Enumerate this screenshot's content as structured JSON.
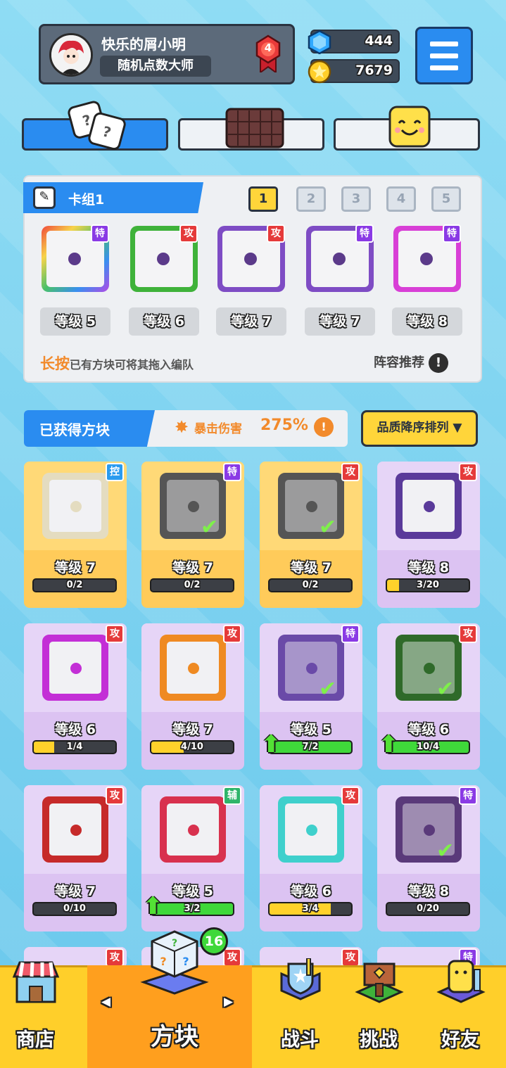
{
  "profile": {
    "name": "快乐的屑小明",
    "title": "随机点数大师",
    "rank": "4"
  },
  "currency": {
    "gems": "444",
    "coins": "7679"
  },
  "deck": {
    "title": "卡组1",
    "pages": [
      "1",
      "2",
      "3",
      "4",
      "5"
    ],
    "slots": [
      {
        "level": "等级 5",
        "tag": "特",
        "color": "rainbow"
      },
      {
        "level": "等级 6",
        "tag": "攻",
        "color": "#3fb23a"
      },
      {
        "level": "等级 7",
        "tag": "攻",
        "color": "#7e4cc4"
      },
      {
        "level": "等级 7",
        "tag": "特",
        "color": "#7e4cc4"
      },
      {
        "level": "等级 8",
        "tag": "特",
        "color": "#d83fd6"
      }
    ],
    "hint_key": "长按",
    "hint": "已有方块可将其拖入编队",
    "recommend": "阵容推荐"
  },
  "owned": {
    "title": "已获得方块",
    "crit_label": "暴击伤害",
    "crit_value": "275%",
    "sort": "品质降序排列",
    "cards": [
      {
        "level": "等级 7",
        "progress": "0/2",
        "fill": 0,
        "tag": "控",
        "gold": true,
        "die": "#e4dcc0",
        "check": false,
        "up": false
      },
      {
        "level": "等级 7",
        "progress": "0/2",
        "fill": 0,
        "tag": "特",
        "gold": true,
        "die": "#555",
        "check": true,
        "up": false
      },
      {
        "level": "等级 7",
        "progress": "0/2",
        "fill": 0,
        "tag": "攻",
        "gold": true,
        "die": "#555",
        "check": true,
        "up": false
      },
      {
        "level": "等级 8",
        "progress": "3/20",
        "fill": 0.15,
        "tag": "攻",
        "gold": false,
        "die": "#5a3a9a",
        "check": false,
        "up": false
      },
      {
        "level": "等级 6",
        "progress": "1/4",
        "fill": 0.25,
        "tag": "攻",
        "gold": false,
        "die": "#c32fd6",
        "check": false,
        "up": false
      },
      {
        "level": "等级 7",
        "progress": "4/10",
        "fill": 0.4,
        "tag": "攻",
        "gold": false,
        "die": "#ef8a22",
        "check": false,
        "up": false
      },
      {
        "level": "等级 5",
        "progress": "7/2",
        "fill": 1,
        "tag": "特",
        "gold": false,
        "die": "#6a4aa8",
        "check": true,
        "up": true
      },
      {
        "level": "等级 6",
        "progress": "10/4",
        "fill": 1,
        "tag": "攻",
        "gold": false,
        "die": "#2f6a2a",
        "check": true,
        "up": true
      },
      {
        "level": "等级 7",
        "progress": "0/10",
        "fill": 0,
        "tag": "攻",
        "gold": false,
        "die": "#c62a2a",
        "check": false,
        "up": false
      },
      {
        "level": "等级 5",
        "progress": "3/2",
        "fill": 1,
        "tag": "辅",
        "gold": false,
        "die": "#d8314e",
        "check": false,
        "up": true
      },
      {
        "level": "等级 6",
        "progress": "3/4",
        "fill": 0.75,
        "tag": "攻",
        "gold": false,
        "die": "#3fd0cc",
        "check": false,
        "up": false
      },
      {
        "level": "等级 8",
        "progress": "0/20",
        "fill": 0,
        "tag": "特",
        "gold": false,
        "die": "#5a3a7a",
        "check": true,
        "up": false
      }
    ],
    "partial_tags": [
      "攻",
      "攻",
      "攻",
      "特"
    ]
  },
  "nav": {
    "shop": "商店",
    "blocks": "方块",
    "badge": "16",
    "battle": "战斗",
    "challenge": "挑战",
    "friends": "好友"
  }
}
